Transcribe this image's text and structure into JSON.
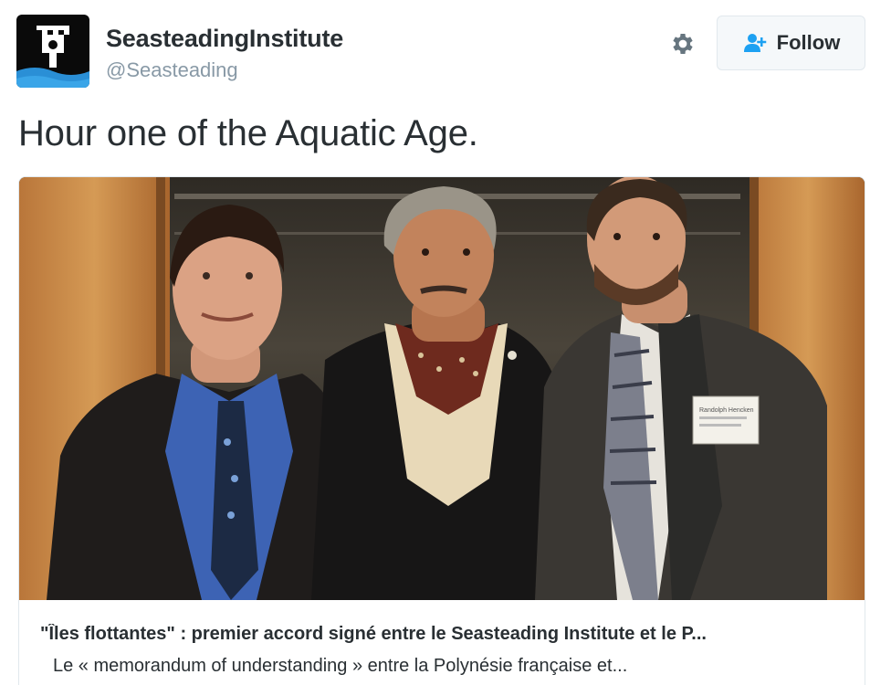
{
  "tweet": {
    "author": {
      "display_name": "SeasteadingInstitute",
      "screen_name": "@Seasteading",
      "avatar_icon": "seasteading-logo-icon"
    },
    "text": "Hour one of the Aquatic Age."
  },
  "actions": {
    "settings_icon": "gear-icon",
    "follow_label": "Follow",
    "follow_icon": "add-user-icon"
  },
  "card": {
    "title": "\"Îles flottantes\" : premier accord signé entre le Seasteading Institute et le P...",
    "description": "Le « memorandum of understanding » entre la Polynésie française et...",
    "image_description": "Three men in suits smiling together",
    "badge_text": "Randolph Hencken"
  },
  "colors": {
    "text": "#292f33",
    "muted": "#8899a6",
    "accent": "#1da1f2",
    "border": "#e1e8ed"
  }
}
